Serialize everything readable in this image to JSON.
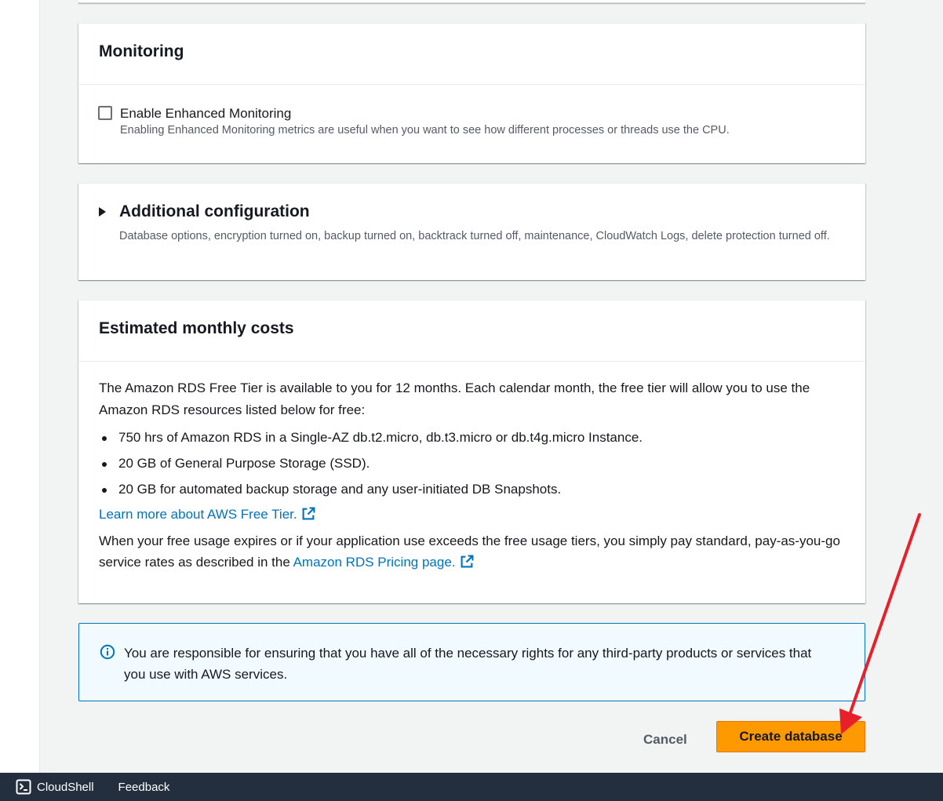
{
  "monitoring": {
    "title": "Monitoring",
    "checkbox_label": "Enable Enhanced Monitoring",
    "checkbox_checked": false,
    "checkbox_description": "Enabling Enhanced Monitoring metrics are useful when you want to see how different processes or threads use the CPU."
  },
  "additional": {
    "title": "Additional configuration",
    "expanded": false,
    "description": "Database options, encryption turned on, backup turned on, backtrack turned off, maintenance, CloudWatch Logs, delete protection turned off."
  },
  "costs": {
    "title": "Estimated monthly costs",
    "intro": "The Amazon RDS Free Tier is available to you for 12 months. Each calendar month, the free tier will allow you to use the Amazon RDS resources listed below for free:",
    "items": [
      "750 hrs of Amazon RDS in a Single-AZ db.t2.micro, db.t3.micro or db.t4g.micro Instance.",
      "20 GB of General Purpose Storage (SSD).",
      "20 GB for automated backup storage and any user-initiated DB Snapshots."
    ],
    "free_tier_link": "Learn more about AWS Free Tier.",
    "after_text": "When your free usage expires or if your application use exceeds the free usage tiers, you simply pay standard, pay-as-you-go service rates as described in the ",
    "pricing_link": "Amazon RDS Pricing page."
  },
  "alert": {
    "text": "You are responsible for ensuring that you have all of the necessary rights for any third-party products or services that you use with AWS services."
  },
  "actions": {
    "cancel_label": "Cancel",
    "create_label": "Create database"
  },
  "footer": {
    "cloudshell_label": "CloudShell",
    "feedback_label": "Feedback"
  },
  "colors": {
    "primary_button": "#ff9900",
    "link": "#0073bb",
    "annotation_arrow": "#e8202a",
    "footer_bg": "#232f3e"
  }
}
